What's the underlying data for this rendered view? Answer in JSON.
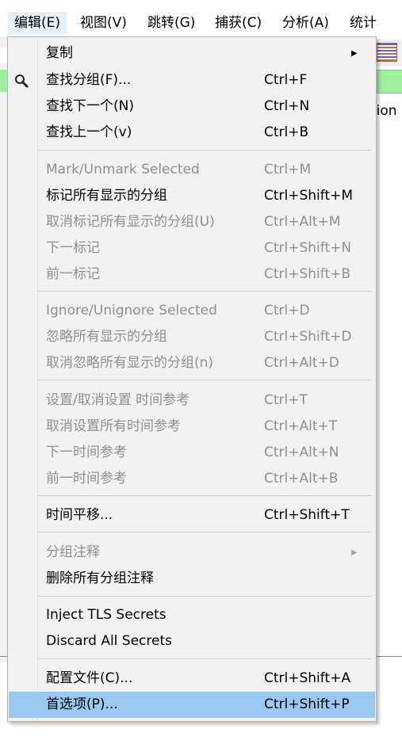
{
  "menubar": {
    "items": [
      "编辑(E)",
      "视图(V)",
      "跳转(G)",
      "捕获(C)",
      "分析(A)",
      "统计(S)"
    ]
  },
  "background": {
    "partial_text": "tion"
  },
  "menu": {
    "items": [
      {
        "label": "复制",
        "shortcut": "",
        "has_submenu": true,
        "enabled": true
      },
      {
        "label": "查找分组(F)...",
        "shortcut": "Ctrl+F",
        "icon": "magnifier-icon",
        "enabled": true
      },
      {
        "label": "查找下一个(N)",
        "shortcut": "Ctrl+N",
        "enabled": true
      },
      {
        "label": "查找上一个(v)",
        "shortcut": "Ctrl+B",
        "enabled": true
      },
      {
        "label": "Mark/Unmark Selected",
        "shortcut": "Ctrl+M",
        "enabled": false
      },
      {
        "label": "标记所有显示的分组",
        "shortcut": "Ctrl+Shift+M",
        "enabled": true
      },
      {
        "label": "取消标记所有显示的分组(U)",
        "shortcut": "Ctrl+Alt+M",
        "enabled": false
      },
      {
        "label": "下一标记",
        "shortcut": "Ctrl+Shift+N",
        "enabled": false
      },
      {
        "label": "前一标记",
        "shortcut": "Ctrl+Shift+B",
        "enabled": false
      },
      {
        "label": "Ignore/Unignore Selected",
        "shortcut": "Ctrl+D",
        "enabled": false
      },
      {
        "label": "忽略所有显示的分组",
        "shortcut": "Ctrl+Shift+D",
        "enabled": false
      },
      {
        "label": "取消忽略所有显示的分组(n)",
        "shortcut": "Ctrl+Alt+D",
        "enabled": false
      },
      {
        "label": "设置/取消设置 时间参考",
        "shortcut": "Ctrl+T",
        "enabled": false
      },
      {
        "label": "取消设置所有时间参考",
        "shortcut": "Ctrl+Alt+T",
        "enabled": false
      },
      {
        "label": "下一时间参考",
        "shortcut": "Ctrl+Alt+N",
        "enabled": false
      },
      {
        "label": "前一时间参考",
        "shortcut": "Ctrl+Alt+B",
        "enabled": false
      },
      {
        "label": "时间平移...",
        "shortcut": "Ctrl+Shift+T",
        "enabled": true
      },
      {
        "label": "分组注释",
        "shortcut": "",
        "has_submenu": true,
        "enabled": false
      },
      {
        "label": "删除所有分组注释",
        "shortcut": "",
        "enabled": true
      },
      {
        "label": "Inject TLS Secrets",
        "shortcut": "",
        "enabled": true
      },
      {
        "label": "Discard All Secrets",
        "shortcut": "",
        "enabled": true
      },
      {
        "label": "配置文件(C)...",
        "shortcut": "Ctrl+Shift+A",
        "enabled": true
      },
      {
        "label": "首选项(P)...",
        "shortcut": "Ctrl+Shift+P",
        "enabled": true,
        "selected": true
      }
    ]
  },
  "colors": {
    "selected_bg": "#99c9f1",
    "disabled_text": "#8f8f8f",
    "menu_bg": "#f2f2f2"
  }
}
